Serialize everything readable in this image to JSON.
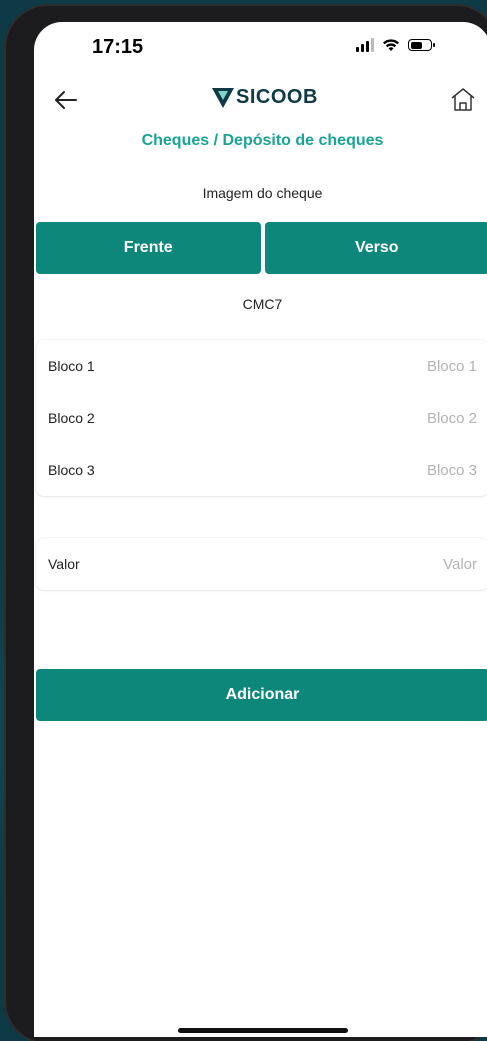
{
  "status_bar": {
    "time": "17:15"
  },
  "header": {
    "logo_text": "SICOOB",
    "back_icon": "arrow-left-icon",
    "home_icon": "home-icon"
  },
  "page": {
    "title": "Cheques / Depósito de cheques",
    "image_label": "Imagem do cheque",
    "segments": [
      {
        "label": "Frente"
      },
      {
        "label": "Verso"
      }
    ],
    "cmc7_label": "CMC7",
    "blocks": [
      {
        "label": "Bloco 1",
        "placeholder": "Bloco 1",
        "value": ""
      },
      {
        "label": "Bloco 2",
        "placeholder": "Bloco 2",
        "value": ""
      },
      {
        "label": "Bloco 3",
        "placeholder": "Bloco 3",
        "value": ""
      }
    ],
    "valor": {
      "label": "Valor",
      "placeholder": "Valor",
      "value": ""
    },
    "add_button": "Adicionar"
  },
  "colors": {
    "accent": "#0e877b",
    "title_accent": "#1ba394",
    "logo": "#0d3a45",
    "background": "#0d3a45"
  }
}
